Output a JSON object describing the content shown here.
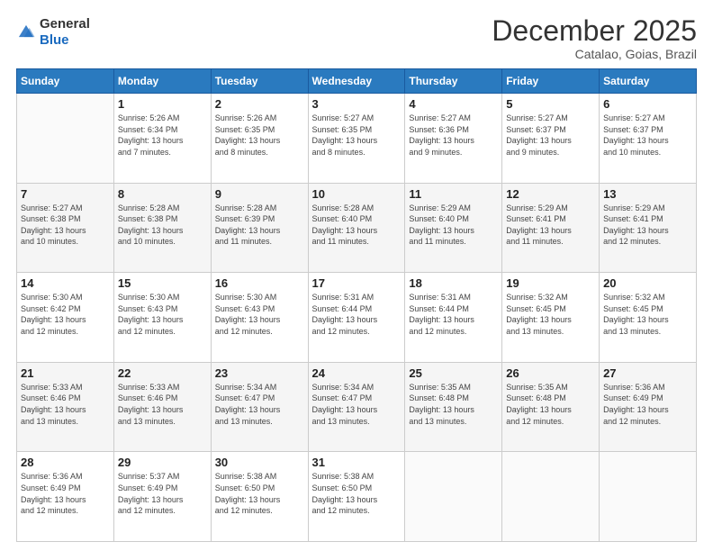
{
  "header": {
    "logo_general": "General",
    "logo_blue": "Blue",
    "month_title": "December 2025",
    "location": "Catalao, Goias, Brazil"
  },
  "calendar": {
    "days_of_week": [
      "Sunday",
      "Monday",
      "Tuesday",
      "Wednesday",
      "Thursday",
      "Friday",
      "Saturday"
    ],
    "weeks": [
      [
        {
          "day": "",
          "info": ""
        },
        {
          "day": "1",
          "info": "Sunrise: 5:26 AM\nSunset: 6:34 PM\nDaylight: 13 hours\nand 7 minutes."
        },
        {
          "day": "2",
          "info": "Sunrise: 5:26 AM\nSunset: 6:35 PM\nDaylight: 13 hours\nand 8 minutes."
        },
        {
          "day": "3",
          "info": "Sunrise: 5:27 AM\nSunset: 6:35 PM\nDaylight: 13 hours\nand 8 minutes."
        },
        {
          "day": "4",
          "info": "Sunrise: 5:27 AM\nSunset: 6:36 PM\nDaylight: 13 hours\nand 9 minutes."
        },
        {
          "day": "5",
          "info": "Sunrise: 5:27 AM\nSunset: 6:37 PM\nDaylight: 13 hours\nand 9 minutes."
        },
        {
          "day": "6",
          "info": "Sunrise: 5:27 AM\nSunset: 6:37 PM\nDaylight: 13 hours\nand 10 minutes."
        }
      ],
      [
        {
          "day": "7",
          "info": "Sunrise: 5:27 AM\nSunset: 6:38 PM\nDaylight: 13 hours\nand 10 minutes."
        },
        {
          "day": "8",
          "info": "Sunrise: 5:28 AM\nSunset: 6:38 PM\nDaylight: 13 hours\nand 10 minutes."
        },
        {
          "day": "9",
          "info": "Sunrise: 5:28 AM\nSunset: 6:39 PM\nDaylight: 13 hours\nand 11 minutes."
        },
        {
          "day": "10",
          "info": "Sunrise: 5:28 AM\nSunset: 6:40 PM\nDaylight: 13 hours\nand 11 minutes."
        },
        {
          "day": "11",
          "info": "Sunrise: 5:29 AM\nSunset: 6:40 PM\nDaylight: 13 hours\nand 11 minutes."
        },
        {
          "day": "12",
          "info": "Sunrise: 5:29 AM\nSunset: 6:41 PM\nDaylight: 13 hours\nand 11 minutes."
        },
        {
          "day": "13",
          "info": "Sunrise: 5:29 AM\nSunset: 6:41 PM\nDaylight: 13 hours\nand 12 minutes."
        }
      ],
      [
        {
          "day": "14",
          "info": "Sunrise: 5:30 AM\nSunset: 6:42 PM\nDaylight: 13 hours\nand 12 minutes."
        },
        {
          "day": "15",
          "info": "Sunrise: 5:30 AM\nSunset: 6:43 PM\nDaylight: 13 hours\nand 12 minutes."
        },
        {
          "day": "16",
          "info": "Sunrise: 5:30 AM\nSunset: 6:43 PM\nDaylight: 13 hours\nand 12 minutes."
        },
        {
          "day": "17",
          "info": "Sunrise: 5:31 AM\nSunset: 6:44 PM\nDaylight: 13 hours\nand 12 minutes."
        },
        {
          "day": "18",
          "info": "Sunrise: 5:31 AM\nSunset: 6:44 PM\nDaylight: 13 hours\nand 12 minutes."
        },
        {
          "day": "19",
          "info": "Sunrise: 5:32 AM\nSunset: 6:45 PM\nDaylight: 13 hours\nand 13 minutes."
        },
        {
          "day": "20",
          "info": "Sunrise: 5:32 AM\nSunset: 6:45 PM\nDaylight: 13 hours\nand 13 minutes."
        }
      ],
      [
        {
          "day": "21",
          "info": "Sunrise: 5:33 AM\nSunset: 6:46 PM\nDaylight: 13 hours\nand 13 minutes."
        },
        {
          "day": "22",
          "info": "Sunrise: 5:33 AM\nSunset: 6:46 PM\nDaylight: 13 hours\nand 13 minutes."
        },
        {
          "day": "23",
          "info": "Sunrise: 5:34 AM\nSunset: 6:47 PM\nDaylight: 13 hours\nand 13 minutes."
        },
        {
          "day": "24",
          "info": "Sunrise: 5:34 AM\nSunset: 6:47 PM\nDaylight: 13 hours\nand 13 minutes."
        },
        {
          "day": "25",
          "info": "Sunrise: 5:35 AM\nSunset: 6:48 PM\nDaylight: 13 hours\nand 13 minutes."
        },
        {
          "day": "26",
          "info": "Sunrise: 5:35 AM\nSunset: 6:48 PM\nDaylight: 13 hours\nand 12 minutes."
        },
        {
          "day": "27",
          "info": "Sunrise: 5:36 AM\nSunset: 6:49 PM\nDaylight: 13 hours\nand 12 minutes."
        }
      ],
      [
        {
          "day": "28",
          "info": "Sunrise: 5:36 AM\nSunset: 6:49 PM\nDaylight: 13 hours\nand 12 minutes."
        },
        {
          "day": "29",
          "info": "Sunrise: 5:37 AM\nSunset: 6:49 PM\nDaylight: 13 hours\nand 12 minutes."
        },
        {
          "day": "30",
          "info": "Sunrise: 5:38 AM\nSunset: 6:50 PM\nDaylight: 13 hours\nand 12 minutes."
        },
        {
          "day": "31",
          "info": "Sunrise: 5:38 AM\nSunset: 6:50 PM\nDaylight: 13 hours\nand 12 minutes."
        },
        {
          "day": "",
          "info": ""
        },
        {
          "day": "",
          "info": ""
        },
        {
          "day": "",
          "info": ""
        }
      ]
    ]
  }
}
